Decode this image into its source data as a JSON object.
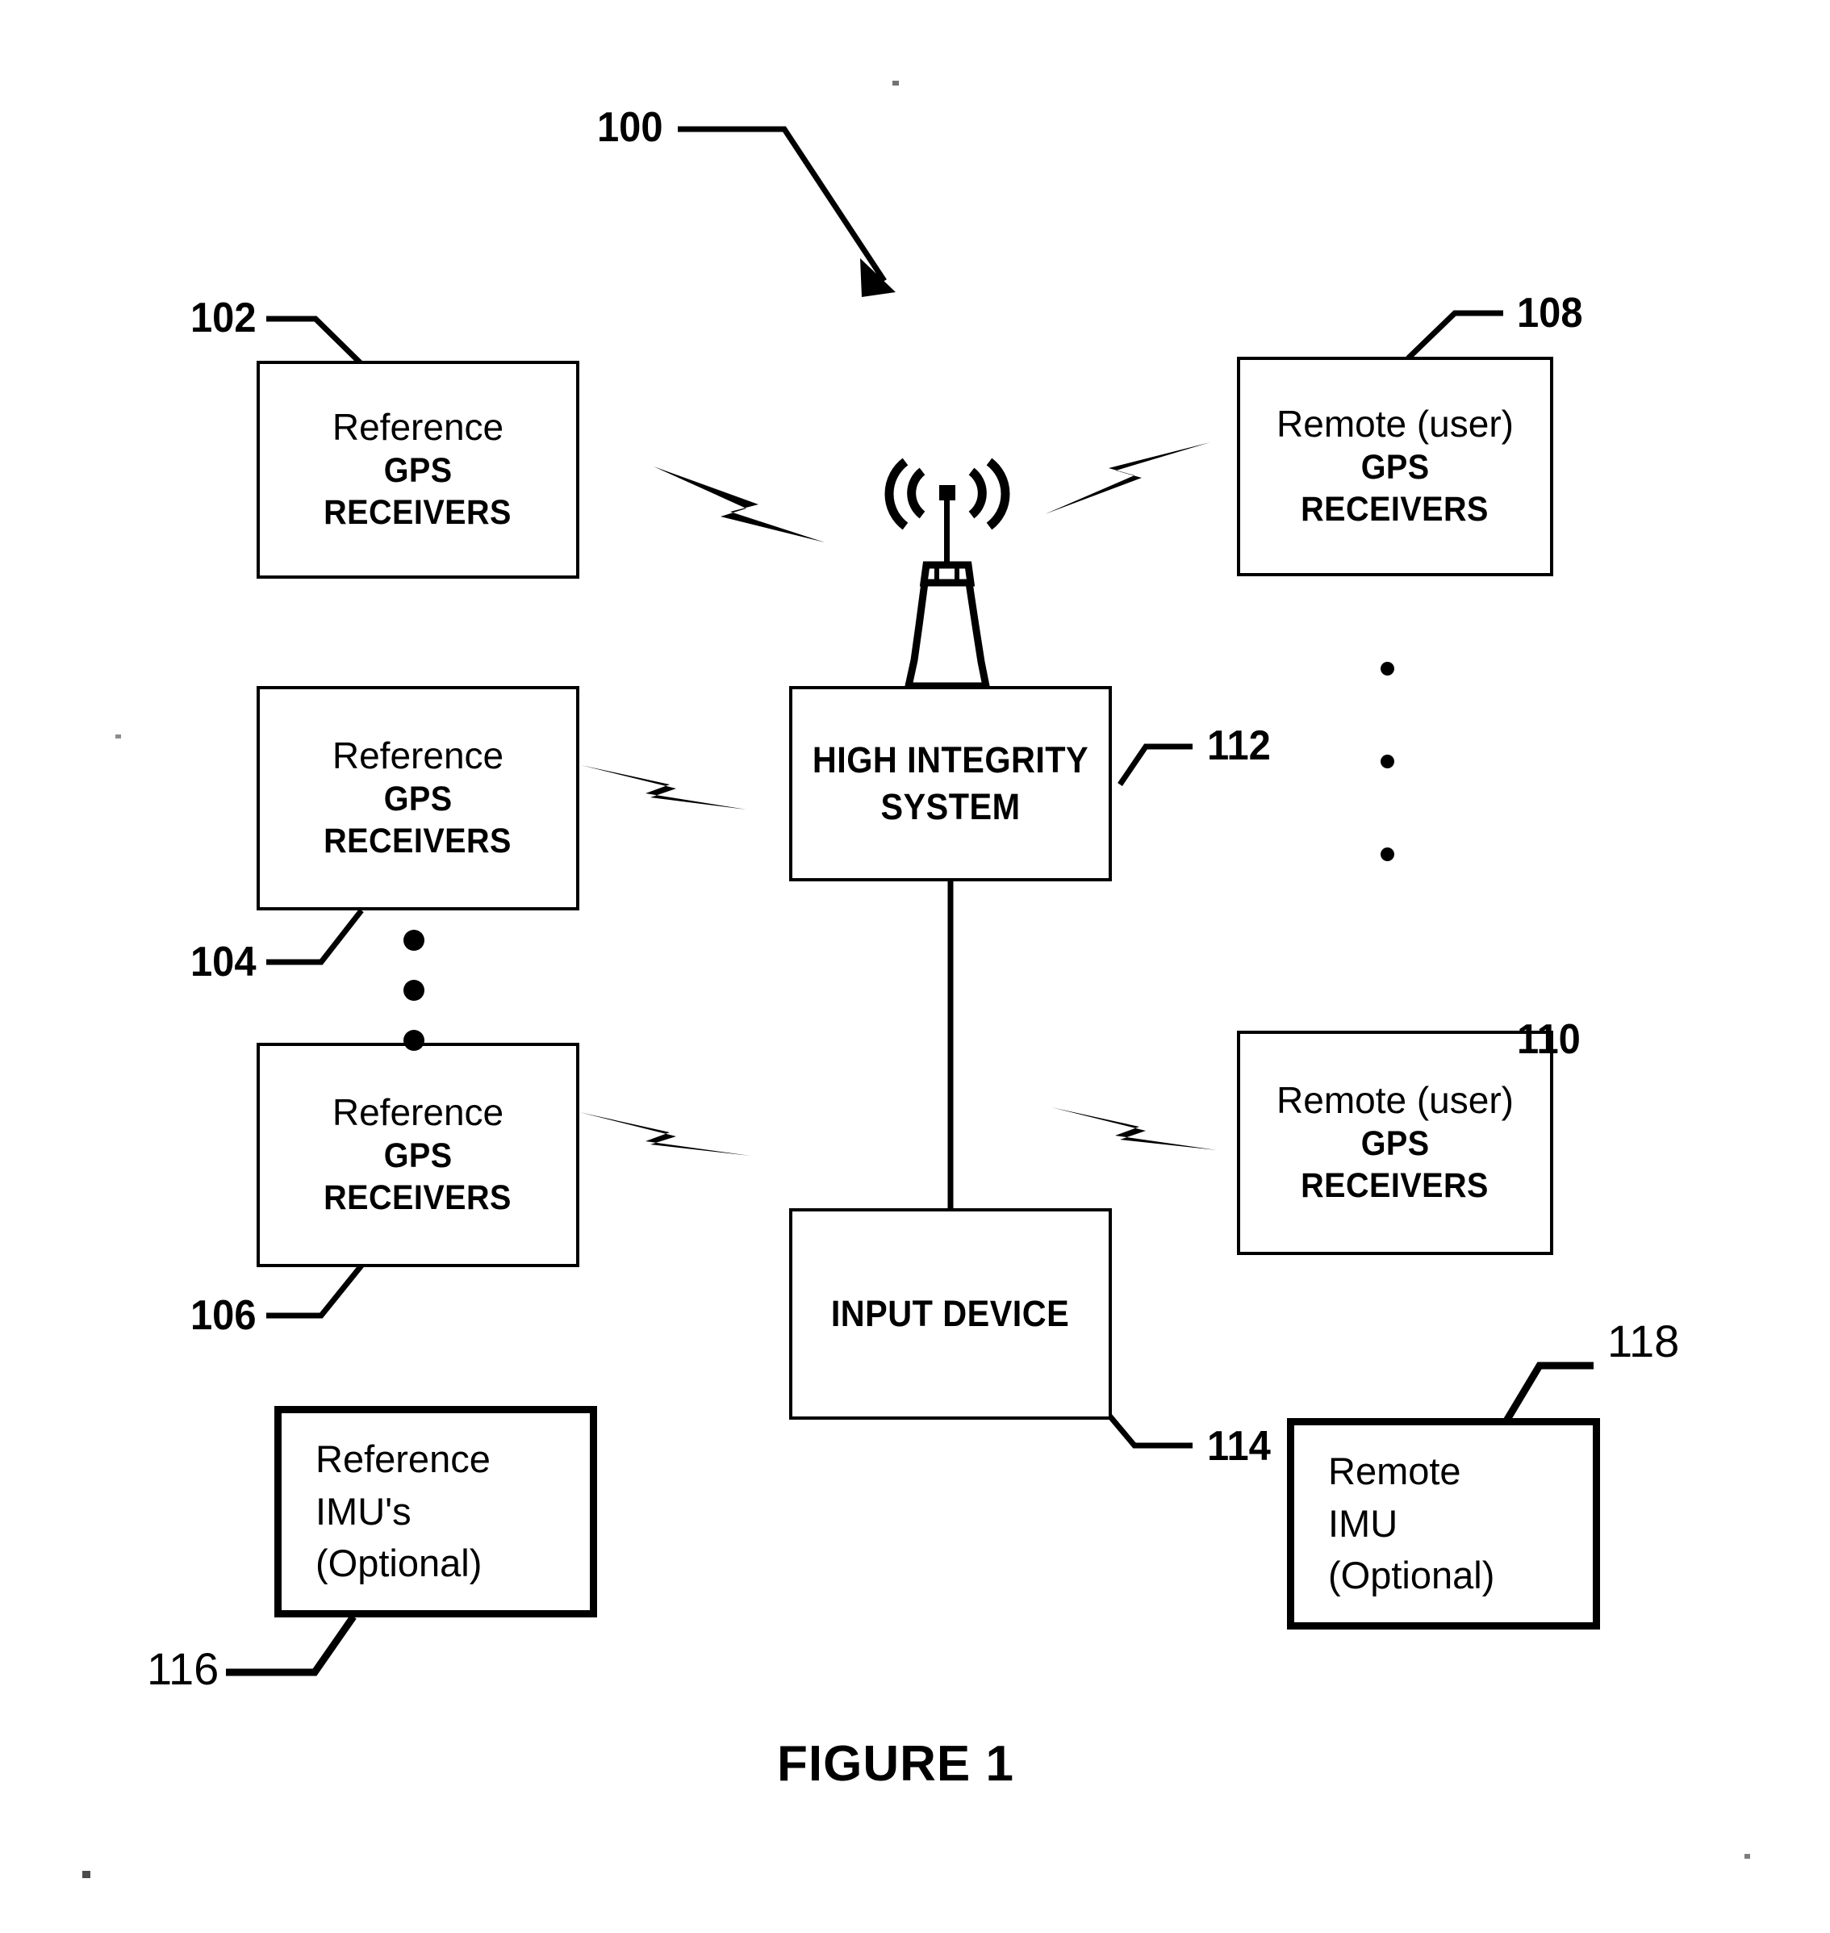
{
  "figure": {
    "caption": "FIGURE 1",
    "system_ref": "100"
  },
  "boxes": [
    {
      "id": "reference-gps-receivers-top",
      "ref": "102",
      "lines": [
        "Reference",
        "GPS",
        "RECEIVERS"
      ]
    },
    {
      "id": "remote-user-gps-receivers-top",
      "ref": "108",
      "lines": [
        "Remote (user)",
        "GPS",
        "RECEIVERS"
      ]
    },
    {
      "id": "reference-gps-receivers-middle",
      "ref": "104",
      "lines": [
        "Reference",
        "GPS",
        "RECEIVERS"
      ]
    },
    {
      "id": "high-integrity-system",
      "ref": "112",
      "lines": [
        "HIGH INTEGRITY",
        "SYSTEM"
      ]
    },
    {
      "id": "reference-gps-receivers-bottom",
      "ref": "106",
      "lines": [
        "Reference",
        "GPS",
        "RECEIVERS"
      ]
    },
    {
      "id": "remote-user-gps-receivers-bottom",
      "ref": "110",
      "lines": [
        "Remote (user)",
        "GPS",
        "RECEIVERS"
      ]
    },
    {
      "id": "input-device",
      "ref": "114",
      "lines": [
        "INPUT DEVICE"
      ]
    },
    {
      "id": "reference-imus-optional",
      "ref": "116",
      "lines": [
        "Reference",
        "IMU's",
        "(Optional)"
      ]
    },
    {
      "id": "remote-imu-optional",
      "ref": "118",
      "lines": [
        "Remote",
        "IMU",
        "(Optional)"
      ]
    }
  ],
  "icons": {
    "antenna": "antenna-tower-icon",
    "wireless_link": "lightning-bolt-icon"
  },
  "colors": {
    "stroke": "#000000",
    "background": "#ffffff"
  }
}
